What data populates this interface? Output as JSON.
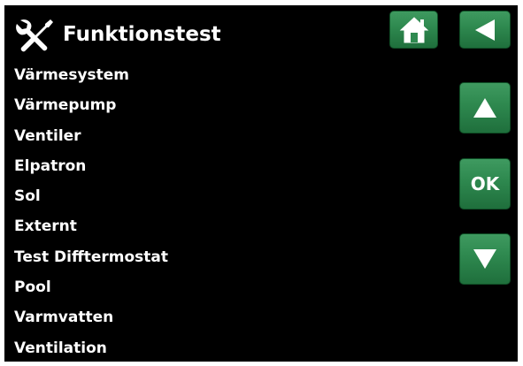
{
  "header": {
    "title": "Funktionstest",
    "icon": "tools-icon"
  },
  "nav": {
    "home_icon": "house-icon",
    "back_icon": "arrow-left-icon",
    "up_icon": "arrow-up-icon",
    "ok_label": "OK",
    "down_icon": "arrow-down-icon"
  },
  "menu": {
    "items": [
      {
        "label": "Värmesystem"
      },
      {
        "label": "Värmepump"
      },
      {
        "label": "Ventiler"
      },
      {
        "label": "Elpatron"
      },
      {
        "label": "Sol"
      },
      {
        "label": "Externt"
      },
      {
        "label": "Test Difftermostat"
      },
      {
        "label": "Pool"
      },
      {
        "label": "Varmvatten"
      },
      {
        "label": "Ventilation"
      }
    ]
  },
  "colors": {
    "background": "#000000",
    "text": "#ffffff",
    "button": "#2f8a50"
  }
}
